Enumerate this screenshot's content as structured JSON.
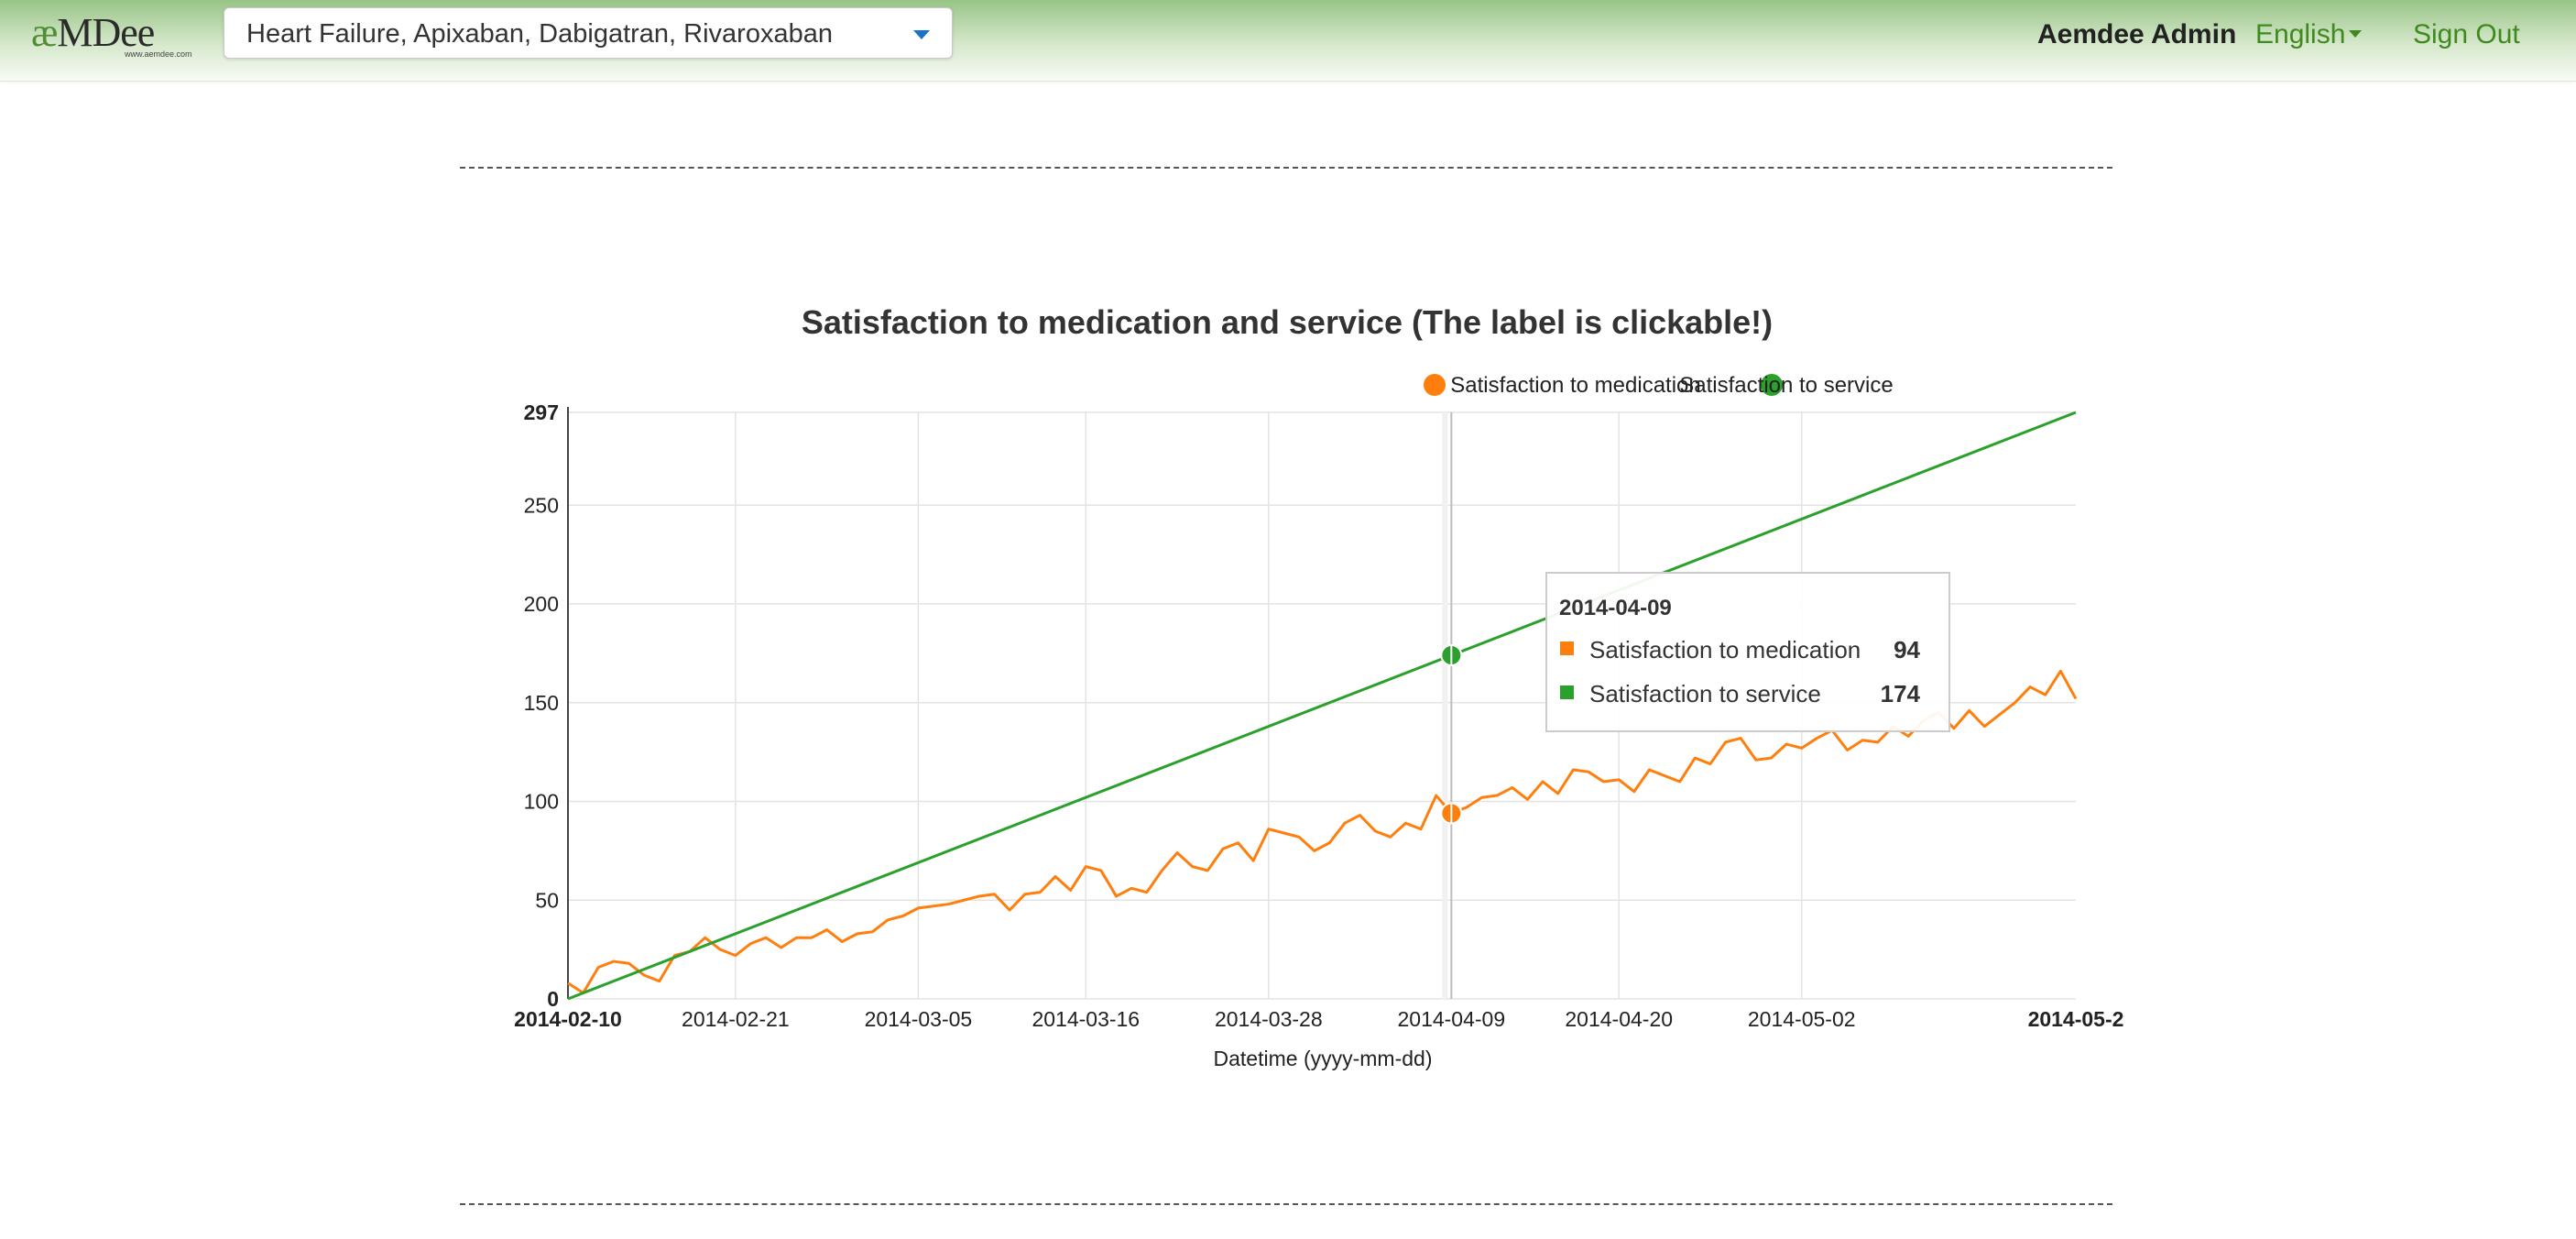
{
  "app": {
    "logo_main_ae": "æ",
    "logo_main_rest": "MDee",
    "logo_url_text": "www.aemdee.com"
  },
  "nav": {
    "selector_value": "Heart Failure, Apixaban, Dabigatran, Rivaroxaban",
    "user": "Aemdee Admin",
    "language": "English",
    "sign_out": "Sign Out"
  },
  "colors": {
    "medication": "#ff7f0e",
    "service": "#2ca02c",
    "link_green": "#3e8a1f"
  },
  "tooltip": {
    "date": "2014-04-09",
    "items": [
      {
        "label": "Satisfaction to medication",
        "value": "94"
      },
      {
        "label": "Satisfaction to service",
        "value": "174"
      }
    ]
  },
  "chart_data": {
    "type": "line",
    "title": "Satisfaction to medication and service (The label is clickable!)",
    "xlabel": "Datetime (yyyy-mm-dd)",
    "ylabel": "",
    "ylim": [
      0,
      297
    ],
    "y_ticks": [
      "297",
      "250",
      "200",
      "150",
      "100",
      "50",
      "0"
    ],
    "x_start": "2014-02-10",
    "x_end": "2014-05-20",
    "x_ticks": [
      "2014-02-10",
      "2014-02-21",
      "2014-03-05",
      "2014-03-16",
      "2014-03-28",
      "2014-04-09",
      "2014-04-20",
      "2014-05-02",
      "2014-05-2"
    ],
    "grid": true,
    "legend_position": "top-right",
    "highlight_date": "2014-04-09",
    "series": [
      {
        "name": "Satisfaction to medication",
        "color": "#ff7f0e",
        "x": [
          "2014-02-10",
          "2014-02-11",
          "2014-02-12",
          "2014-02-13",
          "2014-02-14",
          "2014-02-15",
          "2014-02-16",
          "2014-02-17",
          "2014-02-18",
          "2014-02-19",
          "2014-02-20",
          "2014-02-21",
          "2014-02-22",
          "2014-02-23",
          "2014-02-24",
          "2014-02-25",
          "2014-02-26",
          "2014-02-27",
          "2014-02-28",
          "2014-03-01",
          "2014-03-02",
          "2014-03-03",
          "2014-03-04",
          "2014-03-05",
          "2014-03-06",
          "2014-03-07",
          "2014-03-08",
          "2014-03-09",
          "2014-03-10",
          "2014-03-11",
          "2014-03-12",
          "2014-03-13",
          "2014-03-14",
          "2014-03-15",
          "2014-03-16",
          "2014-03-17",
          "2014-03-18",
          "2014-03-19",
          "2014-03-20",
          "2014-03-21",
          "2014-03-22",
          "2014-03-23",
          "2014-03-24",
          "2014-03-25",
          "2014-03-26",
          "2014-03-27",
          "2014-03-28",
          "2014-03-29",
          "2014-03-30",
          "2014-03-31",
          "2014-04-01",
          "2014-04-02",
          "2014-04-03",
          "2014-04-04",
          "2014-04-05",
          "2014-04-06",
          "2014-04-07",
          "2014-04-08",
          "2014-04-09",
          "2014-04-10",
          "2014-04-11",
          "2014-04-12",
          "2014-04-13",
          "2014-04-14",
          "2014-04-15",
          "2014-04-16",
          "2014-04-17",
          "2014-04-18",
          "2014-04-19",
          "2014-04-20",
          "2014-04-21",
          "2014-04-22",
          "2014-04-23",
          "2014-04-24",
          "2014-04-25",
          "2014-04-26",
          "2014-04-27",
          "2014-04-28",
          "2014-04-29",
          "2014-04-30",
          "2014-05-01",
          "2014-05-02",
          "2014-05-03",
          "2014-05-04",
          "2014-05-05",
          "2014-05-06",
          "2014-05-07",
          "2014-05-08",
          "2014-05-09",
          "2014-05-10",
          "2014-05-11",
          "2014-05-12",
          "2014-05-13",
          "2014-05-14",
          "2014-05-15",
          "2014-05-16",
          "2014-05-17",
          "2014-05-18",
          "2014-05-19",
          "2014-05-20"
        ],
        "values": [
          8,
          3,
          16,
          19,
          18,
          12,
          9,
          22,
          24,
          31,
          25,
          22,
          28,
          31,
          26,
          31,
          31,
          35,
          29,
          33,
          34,
          40,
          42,
          46,
          47,
          48,
          50,
          52,
          53,
          45,
          53,
          54,
          62,
          55,
          67,
          65,
          52,
          56,
          54,
          65,
          74,
          67,
          65,
          76,
          79,
          70,
          86,
          84,
          82,
          75,
          79,
          89,
          93,
          85,
          82,
          89,
          86,
          103,
          94,
          97,
          102,
          103,
          107,
          101,
          110,
          104,
          116,
          115,
          110,
          111,
          105,
          116,
          113,
          110,
          122,
          119,
          130,
          132,
          121,
          122,
          129,
          127,
          132,
          136,
          126,
          131,
          130,
          138,
          133,
          141,
          145,
          137,
          146,
          138,
          144,
          150,
          158,
          154,
          166,
          152
        ]
      },
      {
        "name": "Satisfaction to service",
        "color": "#2ca02c",
        "x": [
          "2014-02-10",
          "2014-05-20"
        ],
        "values": [
          0,
          297
        ]
      }
    ]
  }
}
